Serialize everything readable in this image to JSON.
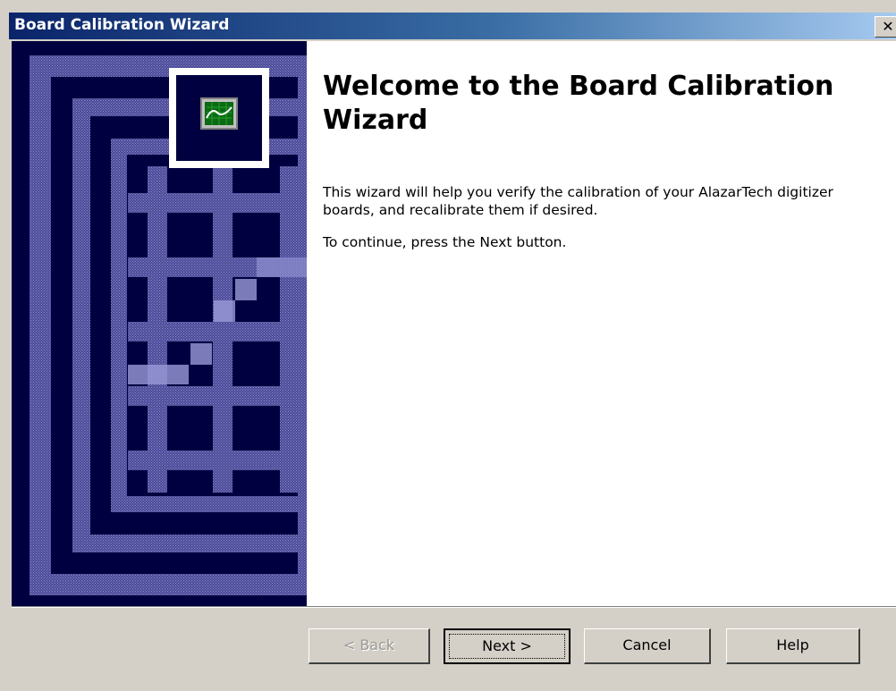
{
  "window": {
    "title": "Board Calibration Wizard",
    "close_glyph": "✕"
  },
  "content": {
    "heading": "Welcome to the Board Calibration Wizard",
    "description": "This wizard will help you verify the calibration of your AlazarTech digitizer boards, and recalibrate them if desired.",
    "prompt": "To continue, press the Next button."
  },
  "buttons": {
    "back": "< Back",
    "next": "Next >",
    "cancel": "Cancel",
    "help": "Help"
  },
  "icons": {
    "banner_icon": "oscilloscope-icon",
    "close": "close-icon"
  },
  "colors": {
    "title_start": "#0a246a",
    "title_end": "#a6caf0",
    "banner_bg": "#000040",
    "banner_grid": "#6060a8"
  }
}
